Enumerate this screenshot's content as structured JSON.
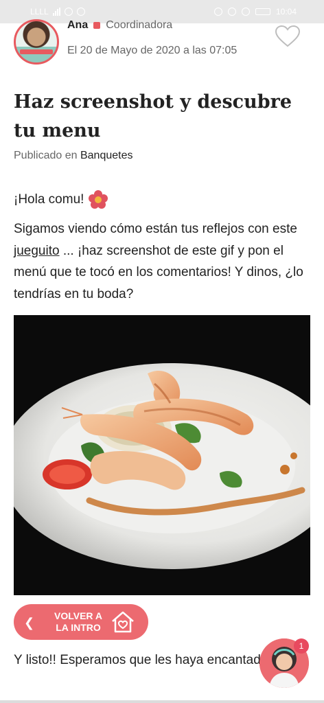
{
  "status_bar": {
    "carrier": "LLLL",
    "time": "10:04"
  },
  "post": {
    "author_name": "Ana",
    "author_role": "Coordinadora",
    "date": "El 20 de Mayo de 2020 a las 07:05",
    "title": "Haz screenshot y descubre tu menu",
    "published_prefix": "Publicado en",
    "category": "Banquetes",
    "greeting": "¡Hola comu!",
    "paragraph_before_link": "Sigamos viendo cómo están tus reflejos con este ",
    "paragraph_link": "jueguito",
    "paragraph_after_link": " ... ¡haz screenshot de este gif y pon el menú que te tocó en los comentarios! Y dinos, ¿lo tendrías en tu boda?",
    "bottom_text": "Y listo!! Esperamos que les haya encantado este jueguito... les dejamos algunos otros"
  },
  "back_button": {
    "label": "VOLVER A LA INTRO"
  },
  "notification": {
    "count": "1"
  },
  "colors": {
    "accent": "#ec6a70",
    "badge": "#e84a5f"
  },
  "icons": {
    "like": "heart-outline-icon",
    "back": "chevron-left-icon",
    "home": "house-heart-icon",
    "emoji": "flower-emoji-icon"
  }
}
